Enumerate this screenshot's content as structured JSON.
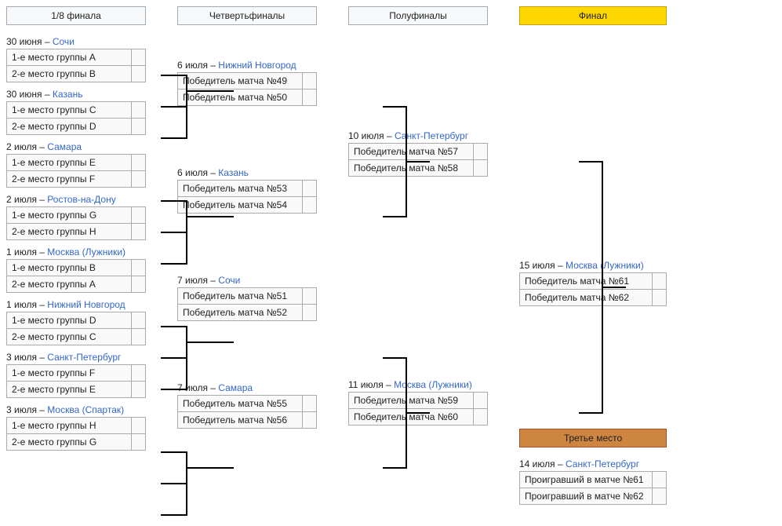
{
  "headers": {
    "r16": "1/8 финала",
    "qf": "Четвертьфиналы",
    "sf": "Полуфиналы",
    "final": "Финал",
    "third": "Третье место"
  },
  "r16": [
    {
      "date": "30 июня",
      "city": "Сочи",
      "t1": "1-е место группы A",
      "t2": "2-е место группы B"
    },
    {
      "date": "30 июня",
      "city": "Казань",
      "t1": "1-е место группы C",
      "t2": "2-е место группы D"
    },
    {
      "date": "2 июля",
      "city": "Самара",
      "t1": "1-е место группы E",
      "t2": "2-е место группы F"
    },
    {
      "date": "2 июля",
      "city": "Ростов-на-Дону",
      "t1": "1-е место группы G",
      "t2": "2-е место группы H"
    },
    {
      "date": "1 июля",
      "city": "Москва (Лужники)",
      "t1": "1-е место группы B",
      "t2": "2-е место группы A"
    },
    {
      "date": "1 июля",
      "city": "Нижний Новгород",
      "t1": "1-е место группы D",
      "t2": "2-е место группы C"
    },
    {
      "date": "3 июля",
      "city": "Санкт-Петербург",
      "t1": "1-е место группы F",
      "t2": "2-е место группы E"
    },
    {
      "date": "3 июля",
      "city": "Москва (Спартак)",
      "t1": "1-е место группы H",
      "t2": "2-е место группы G"
    }
  ],
  "qf": [
    {
      "date": "6 июля",
      "city": "Нижний Новгород",
      "t1": "Победитель матча №49",
      "t2": "Победитель матча №50"
    },
    {
      "date": "6 июля",
      "city": "Казань",
      "t1": "Победитель матча №53",
      "t2": "Победитель матча №54"
    },
    {
      "date": "7 июля",
      "city": "Сочи",
      "t1": "Победитель матча №51",
      "t2": "Победитель матча №52"
    },
    {
      "date": "7 июля",
      "city": "Самара",
      "t1": "Победитель матча №55",
      "t2": "Победитель матча №56"
    }
  ],
  "sf": [
    {
      "date": "10 июля",
      "city": "Санкт-Петербург",
      "t1": "Победитель матча №57",
      "t2": "Победитель матча №58"
    },
    {
      "date": "11 июля",
      "city": "Москва (Лужники)",
      "t1": "Победитель матча №59",
      "t2": "Победитель матча №60"
    }
  ],
  "final": {
    "date": "15 июля",
    "city": "Москва (Лужники)",
    "t1": "Победитель матча №61",
    "t2": "Победитель матча №62"
  },
  "third": {
    "date": "14 июля",
    "city": "Санкт-Петербург",
    "t1": "Проигравший в матче №61",
    "t2": "Проигравший в матче №62"
  },
  "sep": " – "
}
